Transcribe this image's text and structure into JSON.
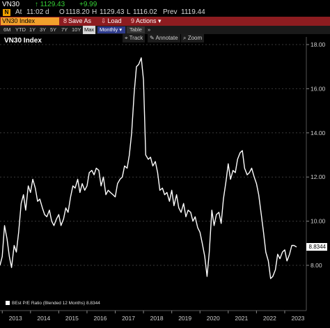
{
  "quote": {
    "ticker": "VN30",
    "last_up": "↑ 1129.43",
    "change": "+9.99",
    "tag": "N",
    "at_label": "At",
    "at_value": "11:02 d",
    "open_label": "O",
    "open_value": "1118.20",
    "high_label": "H",
    "high_value": "1129.43",
    "low_label": "L",
    "low_value": "1116.02",
    "prev_label": "Prev",
    "prev_value": "1119.44"
  },
  "toolbar": {
    "ticker_box": "VN30 Index",
    "save_num": "8",
    "save_label": "Save As",
    "load_num": "",
    "load_label": "Load",
    "actions_num": "9",
    "actions_label": "Actions",
    "actions_suffix": "▾"
  },
  "ranges": {
    "items": [
      "6M",
      "YTD",
      "1Y",
      "3Y",
      "5Y",
      "7Y",
      "10Y",
      "Max"
    ],
    "selected": "Max",
    "period": "Monthly",
    "table": "Table",
    "more": "»"
  },
  "chart_tools": {
    "track": "Track",
    "annotate": "Annotate",
    "zoom": "Zoom"
  },
  "colors": {
    "toolbar_red": "#8d1c20",
    "ticker_orange": "#f2a12c",
    "up_green": "#35d235",
    "period_blue": "#2e3b8c",
    "line": "#ffffff"
  },
  "chart_data": {
    "type": "line",
    "title": "VN30 Index",
    "legend": "BEst P/E Ratio (Blended 12 Months) 8.8344",
    "last_value_label": "8.8344",
    "y_ticks": [
      "18.00",
      "16.00",
      "14.00",
      "12.00",
      "10.00",
      "8.00"
    ],
    "x_ticks": [
      "2013",
      "2014",
      "2015",
      "2016",
      "2017",
      "2018",
      "2019",
      "2020",
      "2021",
      "2022",
      "2023"
    ],
    "ylim": [
      6.5,
      18.5
    ],
    "xlim": [
      2012.9,
      2023.8
    ],
    "grid": "horizontal-dashed",
    "series": [
      {
        "x": [
          2012.92,
          2013.0,
          2013.08,
          2013.17,
          2013.25,
          2013.33,
          2013.42,
          2013.5,
          2013.58,
          2013.67,
          2013.75,
          2013.83,
          2013.92,
          2014.0,
          2014.08,
          2014.17,
          2014.25,
          2014.33,
          2014.42,
          2014.5,
          2014.58,
          2014.67,
          2014.75,
          2014.83,
          2014.92,
          2015.0,
          2015.08,
          2015.17,
          2015.25,
          2015.33,
          2015.42,
          2015.5,
          2015.58,
          2015.67,
          2015.75,
          2015.83,
          2015.92,
          2016.0,
          2016.08,
          2016.17,
          2016.25,
          2016.33,
          2016.42,
          2016.5,
          2016.58,
          2016.67,
          2016.75,
          2016.83,
          2016.92,
          2017.0,
          2017.08,
          2017.17,
          2017.25,
          2017.33,
          2017.42,
          2017.5,
          2017.58,
          2017.67,
          2017.75,
          2017.83,
          2017.92,
          2018.0,
          2018.08,
          2018.17,
          2018.25,
          2018.33,
          2018.42,
          2018.5,
          2018.58,
          2018.67,
          2018.75,
          2018.83,
          2018.92,
          2019.0,
          2019.08,
          2019.17,
          2019.25,
          2019.33,
          2019.42,
          2019.5,
          2019.58,
          2019.67,
          2019.75,
          2019.83,
          2019.92,
          2020.0,
          2020.08,
          2020.17,
          2020.25,
          2020.33,
          2020.42,
          2020.5,
          2020.58,
          2020.67,
          2020.75,
          2020.83,
          2020.92,
          2021.0,
          2021.08,
          2021.17,
          2021.25,
          2021.33,
          2021.42,
          2021.5,
          2021.58,
          2021.67,
          2021.75,
          2021.83,
          2021.92,
          2022.0,
          2022.08,
          2022.17,
          2022.25,
          2022.33,
          2022.42,
          2022.5,
          2022.58,
          2022.67,
          2022.75,
          2022.83,
          2022.92,
          2023.0,
          2023.08,
          2023.17,
          2023.25,
          2023.33,
          2023.42
        ],
        "values": [
          8.0,
          8.4,
          9.8,
          9.2,
          8.4,
          7.9,
          8.9,
          8.6,
          9.5,
          10.8,
          11.2,
          10.5,
          11.6,
          11.3,
          11.9,
          11.5,
          10.9,
          11.0,
          10.6,
          10.3,
          10.2,
          10.5,
          10.0,
          9.8,
          10.1,
          10.3,
          9.8,
          10.1,
          10.6,
          10.4,
          11.1,
          11.6,
          11.5,
          11.9,
          11.3,
          11.7,
          11.4,
          11.6,
          12.2,
          12.3,
          12.1,
          12.4,
          12.3,
          11.6,
          12.0,
          11.2,
          11.4,
          11.3,
          11.2,
          11.1,
          11.7,
          11.9,
          12.0,
          12.5,
          12.4,
          13.0,
          14.0,
          15.8,
          17.0,
          17.1,
          17.4,
          16.4,
          13.0,
          12.8,
          12.9,
          12.5,
          12.7,
          12.2,
          11.4,
          11.5,
          11.2,
          11.3,
          10.9,
          11.4,
          10.7,
          11.2,
          10.6,
          10.4,
          10.8,
          10.2,
          10.5,
          10.4,
          10.0,
          10.2,
          9.7,
          9.5,
          9.0,
          8.4,
          7.5,
          8.6,
          10.5,
          9.8,
          10.3,
          10.4,
          9.9,
          11.0,
          11.8,
          12.6,
          11.9,
          12.3,
          12.2,
          12.8,
          13.1,
          13.2,
          12.4,
          12.1,
          12.2,
          12.4,
          12.0,
          11.7,
          11.2,
          10.3,
          9.5,
          8.6,
          8.2,
          7.4,
          7.5,
          7.8,
          8.5,
          8.3,
          8.6,
          8.7,
          8.2,
          8.5,
          8.9,
          8.9,
          8.83
        ]
      }
    ]
  }
}
